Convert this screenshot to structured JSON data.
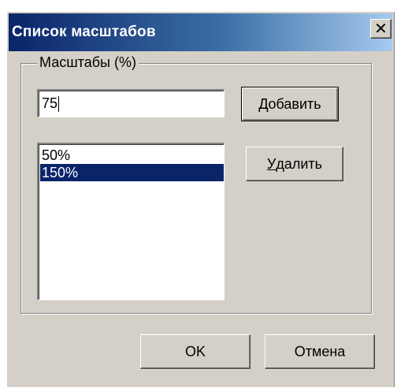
{
  "window": {
    "title": "Список масштабов",
    "close_glyph": "✕"
  },
  "group": {
    "label": "Масштабы (%)"
  },
  "input": {
    "value": "75"
  },
  "list": {
    "items": [
      {
        "label": "50%",
        "selected": false
      },
      {
        "label": "150%",
        "selected": true
      }
    ]
  },
  "buttons": {
    "add": {
      "accel": "Д",
      "rest": "обавить"
    },
    "delete": {
      "accel": "У",
      "rest": "далить"
    },
    "ok": "OK",
    "cancel": "Отмена"
  },
  "colors": {
    "face": "#d4d0c8",
    "title_active": "#0a246a",
    "selection": "#0a246a"
  },
  "icons": {
    "close": "close-icon"
  }
}
